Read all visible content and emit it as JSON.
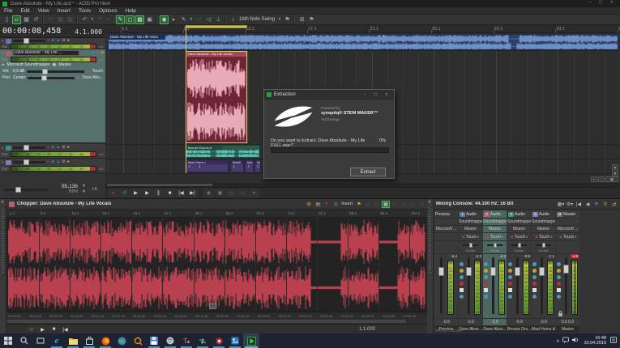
{
  "window": {
    "title": "Dave Absolute - My Life.acd * - ACID Pro Next",
    "menu": [
      "File",
      "Edit",
      "View",
      "Insert",
      "Tools",
      "Options",
      "Help"
    ]
  },
  "toolbar": {
    "swing_label": "16th Note Swing"
  },
  "time_display": {
    "time": "00:00:08,458",
    "beats": "4.1.000"
  },
  "track_panel": {
    "out_label": "Out",
    "inf_label": "-Inf.",
    "meter_scale": [
      "51",
      "45",
      "39",
      "33",
      "27",
      "21",
      "15",
      "9"
    ],
    "track2": {
      "name": "Dave Absolute - My Life ...",
      "device": "Microsoft Soundmapper",
      "bus": "Master",
      "vol_label": "Vol:",
      "vol_value": "-0,9 dB",
      "automation": "Touch",
      "pan_label": "Pan:",
      "pan_value": "Center",
      "send": "Dave Abs..."
    },
    "tempo": {
      "bpm_value": "85,136",
      "bpm_label": "BPM",
      "time_sig_top": "4",
      "time_sig_bottom": "4"
    }
  },
  "timeline": {
    "ruler_marks": [
      "5.1",
      "9.1",
      "13.1",
      "17.1",
      "21.1",
      "25.1",
      "29.1",
      "33.1",
      "37.1"
    ],
    "clips": {
      "track1": "Dave Absolute - My Life Voca",
      "track2": "Dave Absolute - My Life Vocals",
      "track3": "Bronze Drums A",
      "track4": [
        "Mad Horns I",
        "Mad0",
        "Mad0",
        "Mad0"
      ]
    }
  },
  "dialog": {
    "title": "Extraction",
    "powered_by": "Powered by",
    "brand": "zynaptiq® STEM MAKER™",
    "technology": "Technology",
    "question": "Do you want to Extract: Dave Absolute - My Life FULL.wav?",
    "percent": "0%",
    "extract_button": "Extract"
  },
  "chopper": {
    "title": "Chopper: Dave Absolute - My Life Vocals",
    "insert_label": "Insert",
    "ruler_marks": [
      "1.1",
      "8.4",
      "16.4",
      "25.1",
      "33.1",
      "41.1",
      "48.4",
      "56.4",
      "64.4",
      "73.1",
      "81.1",
      "88.4",
      "96.4",
      "104.4"
    ],
    "time_marks": [
      "00:00:00",
      "00:00:15",
      "00:00:30",
      "00:00:45",
      "00:01:00",
      "00:01:15",
      "00:01:30",
      "00:01:45",
      "00:02:00",
      "00:02:15",
      "00:02:30",
      "00:02:45",
      "00:03:00",
      "00:03:15",
      "00:03:30",
      "00:03:45",
      "00:04:00",
      "00:04:15",
      "00:04:30",
      "00:04:45"
    ],
    "position": "1.1.000"
  },
  "mixer": {
    "title": "Mixing Console: 44.100 Hz; 16 Bit",
    "meter_scale": [
      "6",
      "12",
      "18",
      "24",
      "30",
      "36",
      "42",
      "48",
      "54",
      "60",
      "66",
      "72",
      "78",
      "84"
    ],
    "channels": [
      {
        "name": "Preview",
        "route1": "",
        "route2": "Microsoft ...",
        "peak": "-6.4",
        "value": "-0.9",
        "label": "Preview"
      },
      {
        "badge": "1",
        "badge_color": "#5b79b1",
        "type": "Audio",
        "route1": "Soundmapper",
        "route2": "Master",
        "autom": "Touch",
        "pan": "Center",
        "peak": "-2.2",
        "value": "-0.9",
        "label": "Dave Abso...",
        "icons": true
      },
      {
        "badge": "2",
        "badge_color": "#b35f6d",
        "type": "Audio",
        "route1": "Soundmapper",
        "route2": "Master",
        "autom": "Touch",
        "pan": "Center",
        "peak": "-4.3",
        "value": "-0.9",
        "label": "Dave Abso...",
        "icons": true,
        "selected": true
      },
      {
        "badge": "3",
        "badge_color": "#3f8d80",
        "type": "Audio",
        "route1": "Soundmapper",
        "route2": "Master",
        "autom": "Touch",
        "pan": "Center",
        "peak": "-0.9",
        "value": "-0.9",
        "label": "Bronze Dru...",
        "icons": true
      },
      {
        "badge": "4",
        "badge_color": "#8878b8",
        "type": "Audio",
        "route1": "Soundmapper",
        "route2": "Master",
        "autom": "Touch",
        "pan": "Center",
        "peak": "-1.1",
        "value": "-0.9",
        "label": "Mad Horns &",
        "icons": true
      },
      {
        "badge": "M",
        "badge_color": "#6f6f6f",
        "type": "Master",
        "route1": "",
        "route2": "Microsoft ...",
        "autom": "Touch",
        "peak": "-4.8",
        "peak_red": true,
        "value": "0.0  0.0",
        "label": "Master",
        "icons": true,
        "meters": 2,
        "lock": true
      }
    ]
  },
  "taskbar": {
    "time": "16:48",
    "date": "10.04.2019"
  },
  "colors": {
    "accent_green": "#2f9e44",
    "loop_yellow": "#cfc655",
    "clip_blue": "#6e8fc4",
    "clip_red": "#b13c4e",
    "clip_teal": "#5cc2b0",
    "clip_purple": "#9887cf",
    "meter_green": "#7fae3f",
    "peak_red": "#c22525"
  }
}
